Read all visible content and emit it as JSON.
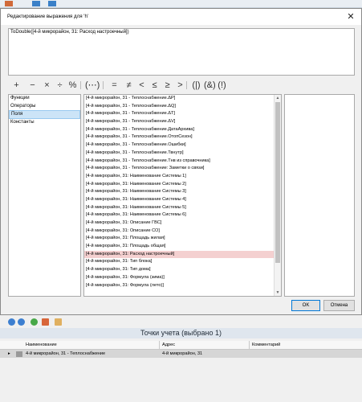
{
  "dialog": {
    "title": "Редактирование выражения для 'h'",
    "close_glyph": "✕",
    "expression": "ToDouble([4-й микрорайон, 31: Расход настроечный])"
  },
  "operators": [
    "+",
    "−",
    "×",
    "÷",
    "%",
    "(⋯)",
    "=",
    "≠",
    "<",
    "≤",
    "≥",
    ">",
    "(|)",
    "(&)",
    "(!)"
  ],
  "categories": {
    "items": [
      "Функции",
      "Операторы",
      "Поля",
      "Константы"
    ],
    "selected_index": 2
  },
  "fields": {
    "items": [
      "[4-й микрорайон, 31 - Теплоснабжение.ΔP]",
      "[4-й микрорайон, 31 - Теплоснабжение.ΔQ]",
      "[4-й микрорайон, 31 - Теплоснабжение.ΔT]",
      "[4-й микрорайон, 31 - Теплоснабжение.ΔV]",
      "[4-й микрорайон, 31 - Теплоснабжение.ДатаАрхива]",
      "[4-й микрорайон, 31 - Теплоснабжение.ОтопСезон]",
      "[4-й микрорайон, 31 - Теплоснабжение.Ошибки]",
      "[4-й микрорайон, 31 - Теплоснабжение.Твнутр]",
      "[4-й микрорайон, 31 - Теплоснабжение.Тнв из справочника]",
      "[4-й микрорайон, 31 - Теплоснабжение: Заметки о связи]",
      "[4-й микрорайон, 31: Наименование Системы 1]",
      "[4-й микрорайон, 31: Наименование Системы 2]",
      "[4-й микрорайон, 31: Наименование Системы 3]",
      "[4-й микрорайон, 31: Наименование Системы 4]",
      "[4-й микрорайон, 31: Наименование Системы 5]",
      "[4-й микрорайон, 31: Наименование Системы 6]",
      "[4-й микрорайон, 31: Описание ГВС]",
      "[4-й микрорайон, 31: Описание СО]",
      "[4-й микрорайон, 31: Площадь жилая]",
      "[4-й микрорайон, 31: Площадь общая]",
      "[4-й микрорайон, 31: Расход настроечный]",
      "[4-й микрорайон, 31: Тип блока]",
      "[4-й микрорайон, 31: Тип дома]",
      "[4-й микрорайон, 31: Формула (зима)]",
      "[4-й микрорайон, 31: Формула (лето)]"
    ],
    "highlighted_index": 20
  },
  "buttons": {
    "ok": "OK",
    "cancel": "Отмена"
  },
  "panel": {
    "title": "Точки учета (выбрано 1)",
    "columns": [
      "Наименование",
      "Адрес",
      "Комментарий"
    ],
    "rows": [
      {
        "name": "4-й микрорайон, 31 - Теплоснабжение",
        "address": "4-й микрорайон, 31",
        "comment": ""
      }
    ]
  },
  "colors": {
    "highlight": "#f4d0d0",
    "selection": "#cce4f7",
    "panel_header": "#dfe6ee"
  }
}
